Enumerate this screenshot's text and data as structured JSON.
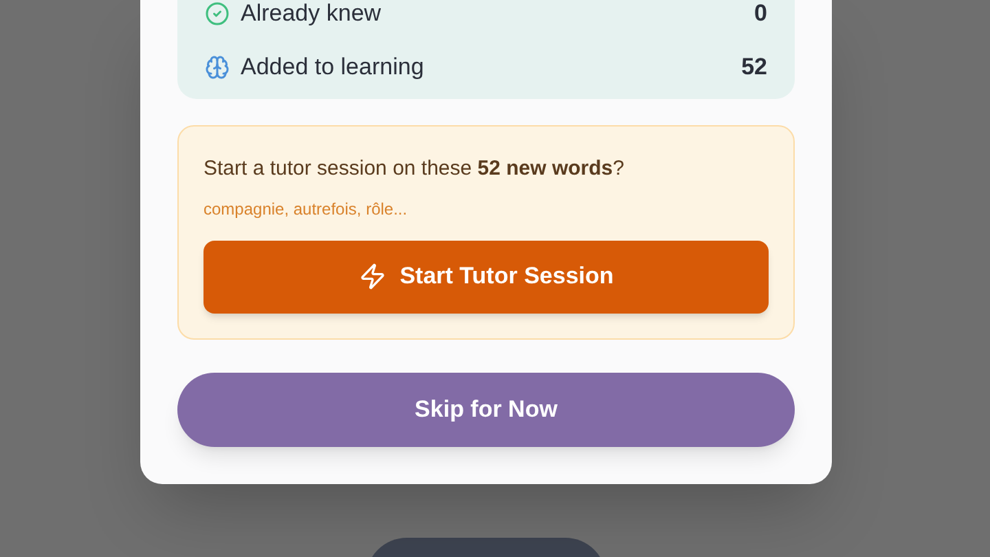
{
  "stats": [
    {
      "kind": "known",
      "label": "Already knew",
      "count": "0"
    },
    {
      "kind": "learning",
      "label": "Added to learning",
      "count": "52"
    }
  ],
  "tutor_prompt": {
    "text": "Start a tutor session on these **52 new words**?",
    "examples": "compagnie, autrefois, rôle...",
    "button": "Start Tutor Session"
  },
  "skip_button": "Skip for Now"
}
